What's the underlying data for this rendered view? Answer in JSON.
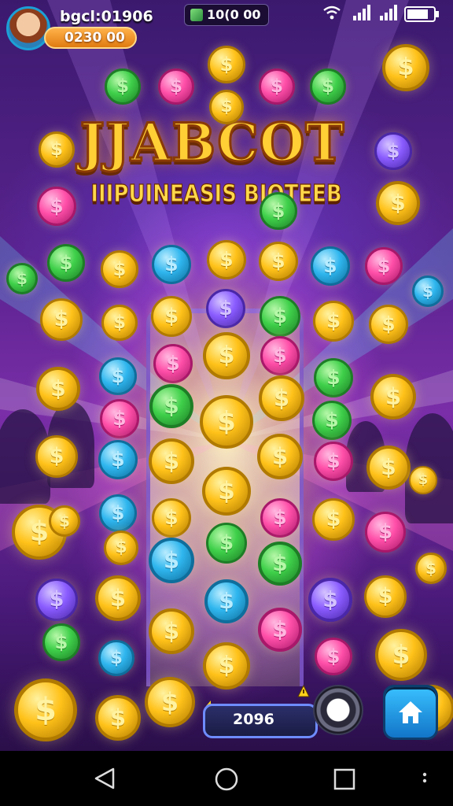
{
  "status_bar": {
    "username": "bgcl:01906",
    "balance": "0230 00",
    "top_counter": "10(0 00"
  },
  "title": {
    "main": "JJABCOT",
    "subtitle": "IIIPUINEASIS BIOTEEB"
  },
  "controls": {
    "score": "2096"
  },
  "icons": {
    "wifi": "wifi-icon",
    "signal": "signal-icon",
    "battery": "battery-icon",
    "home": "home-icon",
    "spin": "spin-knob",
    "back": "nav-back-icon",
    "circle_home": "nav-home-icon",
    "recent": "nav-recent-icon",
    "more": "nav-more-icon"
  },
  "colors": {
    "gold": "#ffc21a",
    "orange": "#ff9a1a",
    "pink": "#ff4fa8",
    "green": "#3fd04a",
    "blue": "#2fb6ee",
    "purple": "#8a5cff"
  }
}
